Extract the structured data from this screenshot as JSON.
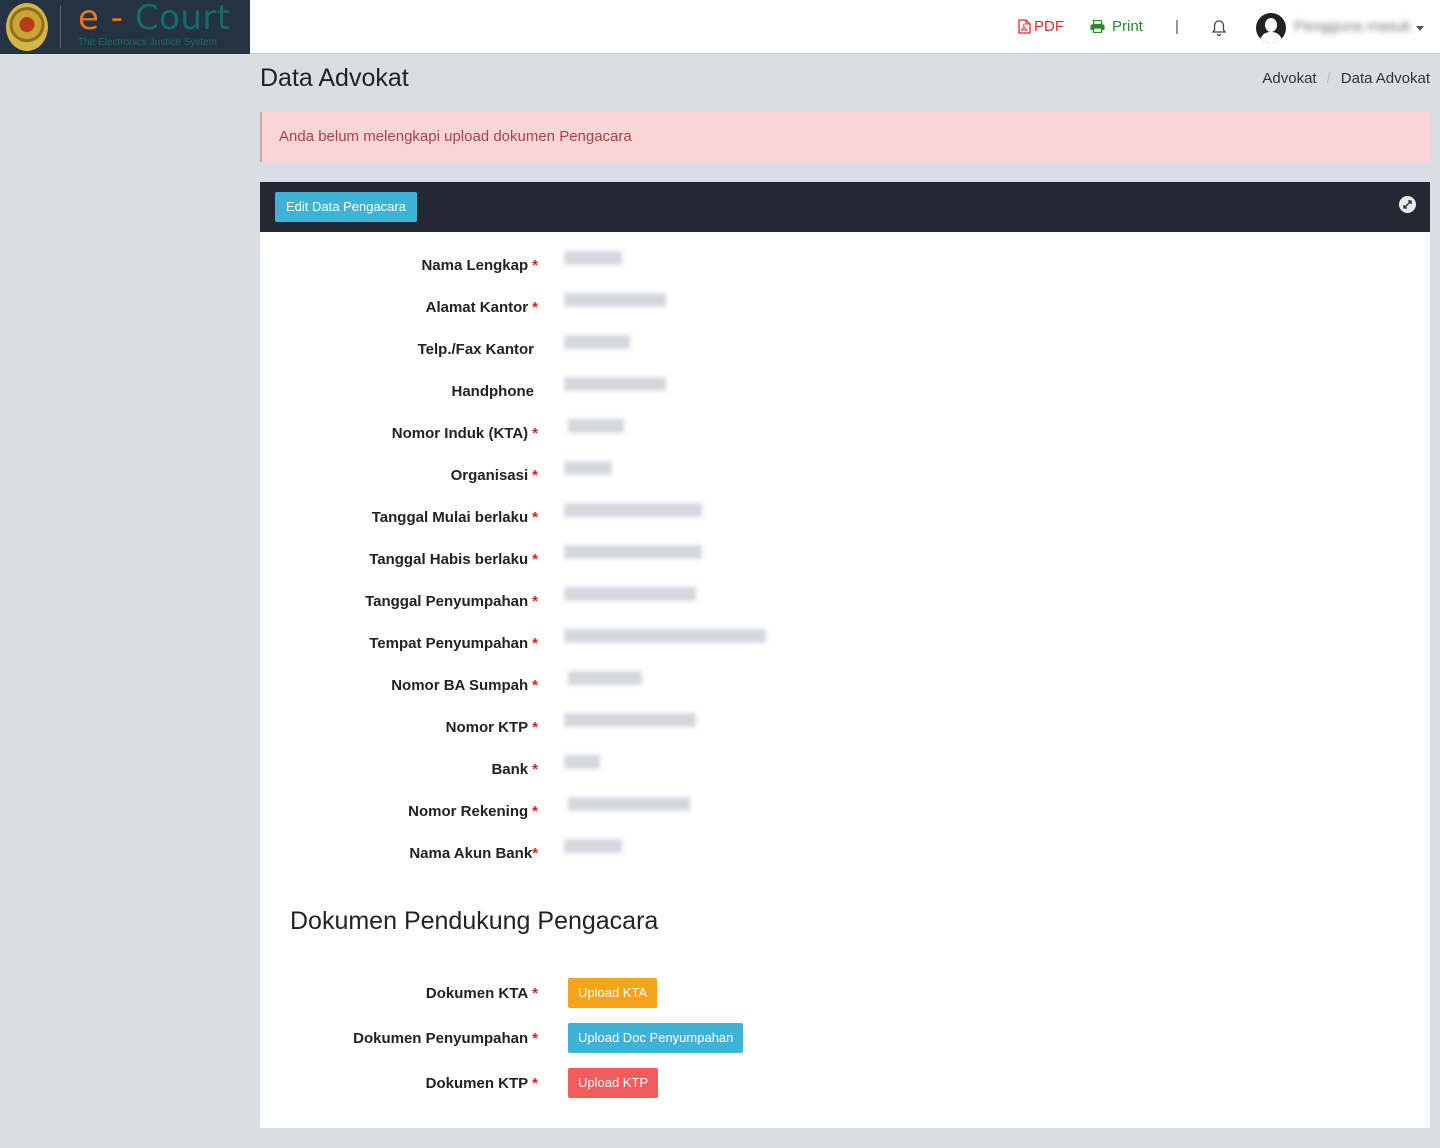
{
  "brand": {
    "title_e": "e",
    "title_dash": "-",
    "title_rest": "Court",
    "subtitle": "The Electronics Justice System"
  },
  "topnav": {
    "pdf": "PDF",
    "print": "Print",
    "separator": "|",
    "user": "Pengguna masuk"
  },
  "page": {
    "title": "Data Advokat",
    "breadcrumb": [
      "Advokat",
      "Data Advokat"
    ]
  },
  "alert": {
    "text": "Anda belum melengkapi upload dokumen Pengacara",
    "color": "#a94442"
  },
  "panel": {
    "edit_button": "Edit Data Pengacara"
  },
  "fields": [
    {
      "label": "Nama Lengkap",
      "required": "*",
      "value": ""
    },
    {
      "label": "Alamat Kantor",
      "required": "*",
      "value": ""
    },
    {
      "label": "Telp./Fax Kantor",
      "required": "",
      "value": ""
    },
    {
      "label": "Handphone",
      "required": "",
      "value": ""
    },
    {
      "label": "Nomor Induk (KTA)",
      "required": "*",
      "value": ""
    },
    {
      "label": "Organisasi",
      "required": "*",
      "value": ""
    },
    {
      "label": "Tanggal Mulai berlaku",
      "required": "*",
      "value": ""
    },
    {
      "label": "Tanggal Habis berlaku",
      "required": "*",
      "value": ""
    },
    {
      "label": "Tanggal Penyumpahan",
      "required": "*",
      "value": ""
    },
    {
      "label": "Tempat Penyumpahan",
      "required": "*",
      "value": ""
    },
    {
      "label": "Nomor BA Sumpah",
      "required": "*",
      "value": ""
    },
    {
      "label": "Nomor KTP",
      "required": "*",
      "value": ""
    },
    {
      "label": "Bank",
      "required": "*",
      "value": ""
    },
    {
      "label": "Nomor Rekening",
      "required": "*",
      "value": ""
    },
    {
      "label": "Nama Akun Bank",
      "required": "*",
      "value": ""
    }
  ],
  "documents": {
    "title": "Dokumen Pendukung Pengacara",
    "items": [
      {
        "label": "Dokumen KTA",
        "required": "*",
        "button": "Upload KTA",
        "color": "#f5a31d"
      },
      {
        "label": "Dokumen Penyumpahan",
        "required": "*",
        "button": "Upload Doc Penyumpahan",
        "color": "#3fb3d7"
      },
      {
        "label": "Dokumen KTP",
        "required": "*",
        "button": "Upload KTP",
        "color": "#f25c5c"
      }
    ]
  }
}
